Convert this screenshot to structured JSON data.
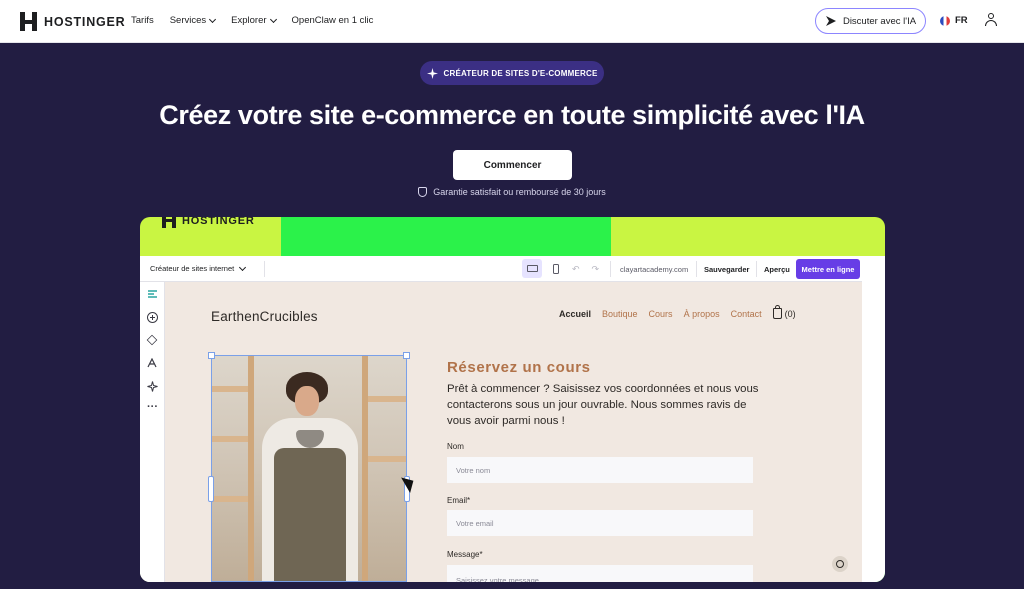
{
  "brand": {
    "name": "HOSTINGER"
  },
  "nav": {
    "links": [
      {
        "label": "Tarifs",
        "dropdown": false
      },
      {
        "label": "Services",
        "dropdown": true
      },
      {
        "label": "Explorer",
        "dropdown": true
      },
      {
        "label": "OpenClaw en 1 clic",
        "dropdown": false
      }
    ],
    "ai_button": "Discuter avec l'IA",
    "language": "FR"
  },
  "hero": {
    "badge": "CRÉATEUR DE SITES D'E-COMMERCE",
    "title": "Créez votre site e-commerce en toute simplicité avec l'IA",
    "cta": "Commencer",
    "guarantee": "Garantie satisfait ou remboursé de 30 jours"
  },
  "preview": {
    "brand": "HOSTINGER",
    "toolbar": {
      "builder_select": "Créateur de sites internet",
      "domain": "clayartacademy.com",
      "save": "Sauvegarder",
      "preview": "Aperçu",
      "publish": "Mettre en ligne"
    },
    "site": {
      "logo": "EarthenCrucibles",
      "nav": [
        "Accueil",
        "Boutique",
        "Cours",
        "À propos",
        "Contact"
      ],
      "cart_count": "(0)",
      "form": {
        "title": "Réservez un cours",
        "text": "Prêt à commencer ? Saisissez vos coordonnées et nous vous contacterons sous un jour ouvrable. Nous sommes ravis de vous avoir parmi nous !",
        "name_label": "Nom",
        "name_placeholder": "Votre nom",
        "email_label": "Email*",
        "email_placeholder": "Votre email",
        "message_label": "Message*",
        "message_placeholder": "Saisissez votre message"
      }
    }
  },
  "colors": {
    "hero_bg": "#221d42",
    "accent_purple": "#673de6",
    "lime": "#c9f542",
    "green": "#2bf24a",
    "terracotta": "#b1734a"
  }
}
